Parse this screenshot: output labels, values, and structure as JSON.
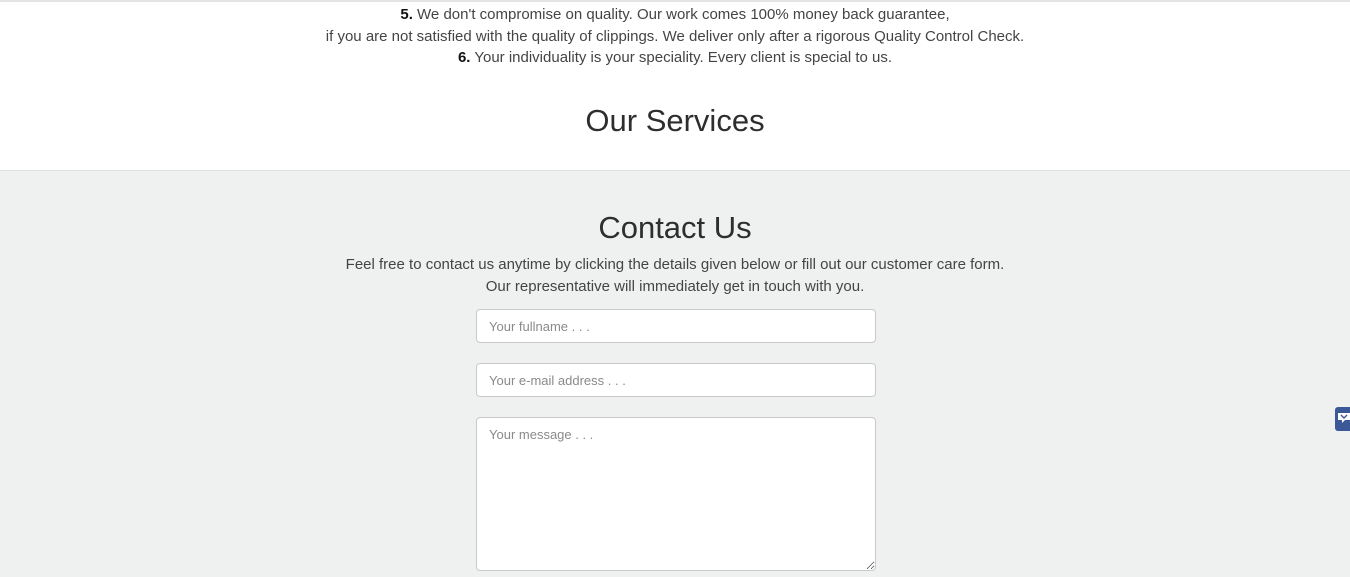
{
  "features": {
    "item5_number": "5.",
    "item5_line1": "We don't compromise on quality. Our work comes 100% money back guarantee,",
    "item5_line2": "if you are not satisfied with the quality of clippings. We deliver only after a rigorous Quality Control Check.",
    "item6_number": "6.",
    "item6_text": "Your individuality is your speciality. Every client is special to us."
  },
  "services": {
    "title": "Our Services"
  },
  "contact": {
    "title": "Contact Us",
    "intro_line1": "Feel free to contact us anytime by clicking the details given below or fill out our customer care form.",
    "intro_line2": "Our representative will immediately get in touch with you.",
    "form": {
      "fullname": {
        "value": "",
        "placeholder": "Your fullname . . ."
      },
      "email": {
        "value": "",
        "placeholder": "Your e-mail address . . ."
      },
      "message": {
        "value": "",
        "placeholder": "Your message . . ."
      }
    }
  },
  "side_tab": {
    "icon": "chat-bubble-icon",
    "color": "#3b5998"
  }
}
